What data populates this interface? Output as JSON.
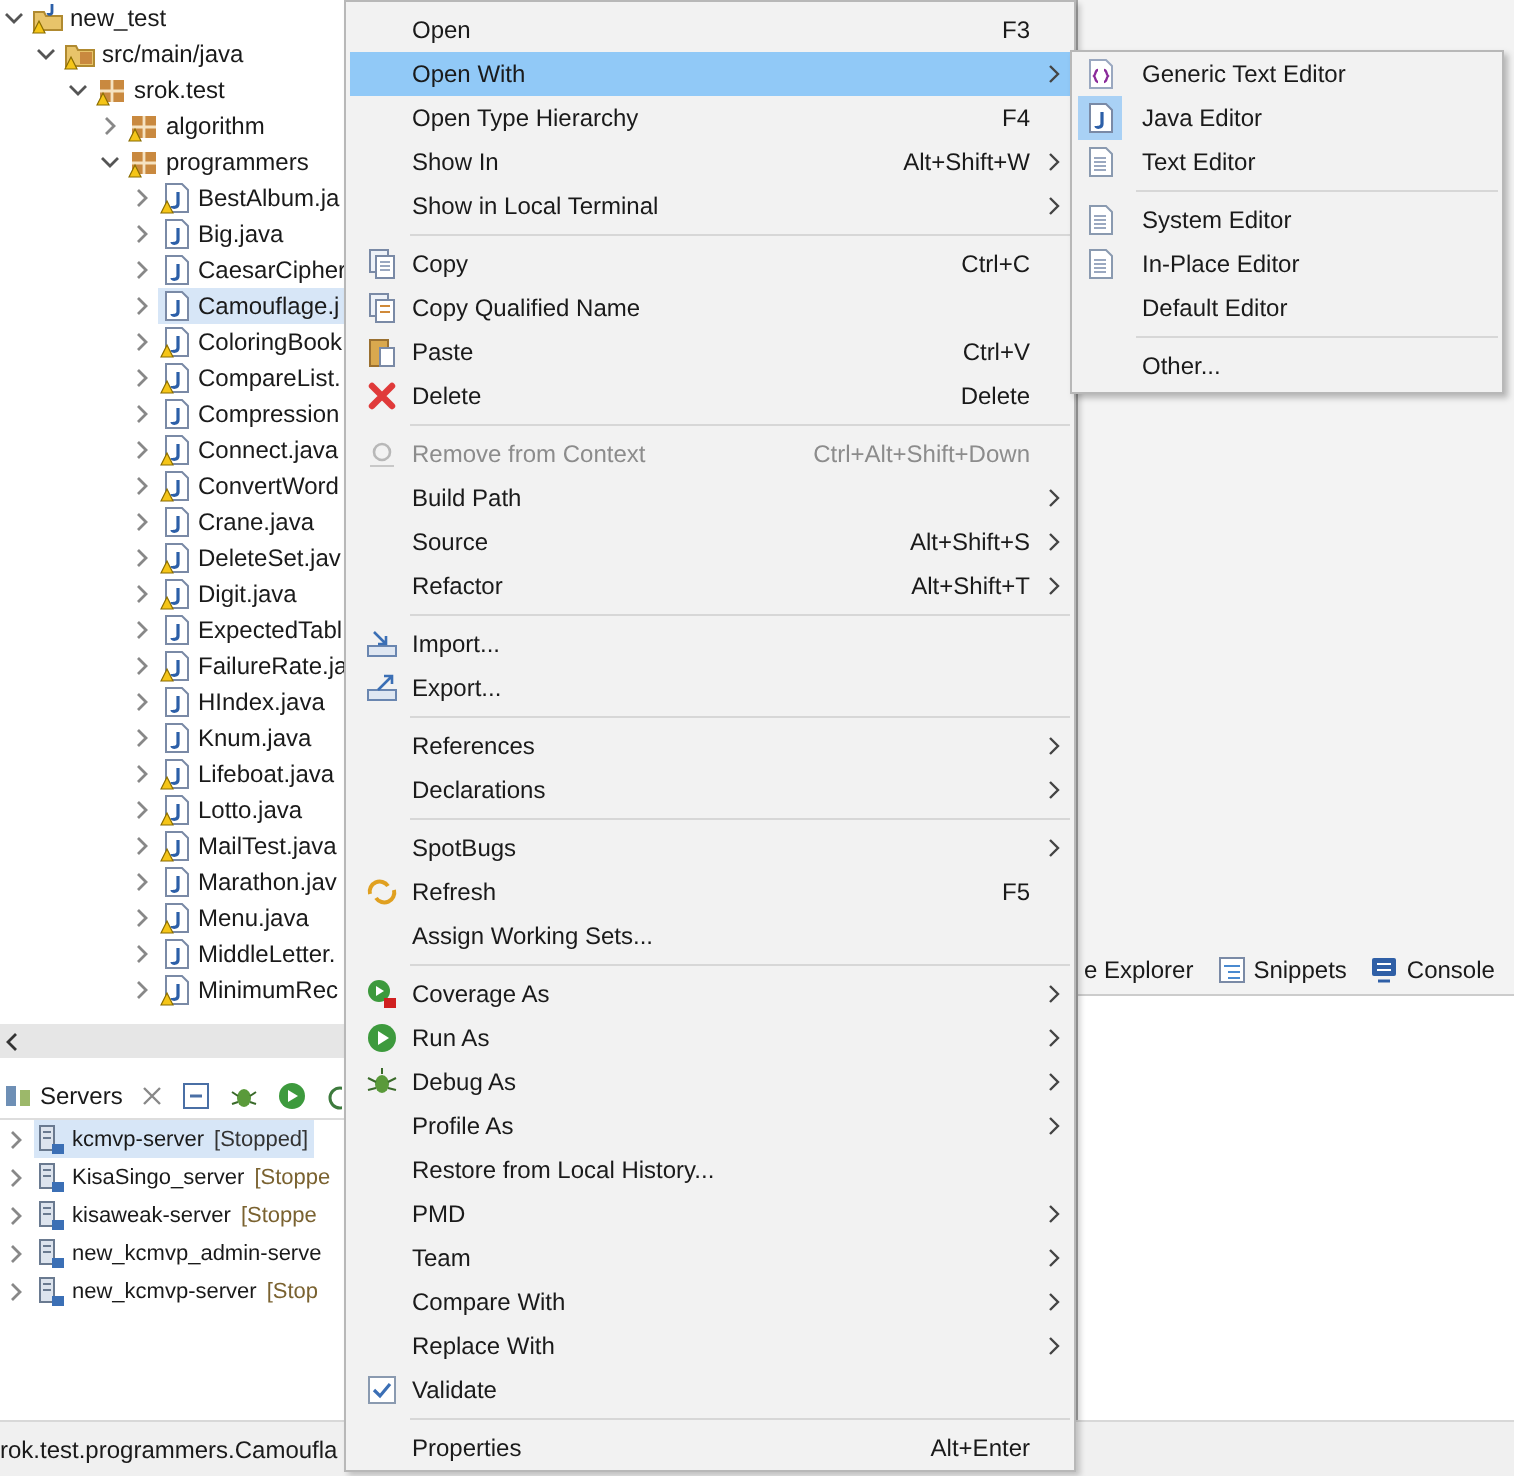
{
  "tree": [
    {
      "label": "new_test",
      "kind": "project",
      "expanded": true,
      "warning": true,
      "selected": false,
      "children": [
        {
          "label": "src/main/java",
          "kind": "source-folder",
          "expanded": true,
          "warning": true,
          "selected": false,
          "children": [
            {
              "label": "srok.test",
              "kind": "package",
              "expanded": true,
              "warning": true,
              "selected": false,
              "children": [
                {
                  "label": "algorithm",
                  "kind": "package",
                  "expanded": false,
                  "warning": true,
                  "selected": false
                },
                {
                  "label": "programmers",
                  "kind": "package",
                  "expanded": true,
                  "warning": true,
                  "selected": false,
                  "children": [
                    {
                      "label": "BestAlbum.ja",
                      "kind": "java-file",
                      "expanded": false,
                      "warning": true,
                      "selected": false
                    },
                    {
                      "label": "Big.java",
                      "kind": "java-file",
                      "expanded": false,
                      "warning": false,
                      "selected": false
                    },
                    {
                      "label": "CaesarCipher",
                      "kind": "java-file",
                      "expanded": false,
                      "warning": false,
                      "selected": false
                    },
                    {
                      "label": "Camouflage.j",
                      "kind": "java-file",
                      "expanded": false,
                      "warning": false,
                      "selected": true
                    },
                    {
                      "label": "ColoringBook",
                      "kind": "java-file",
                      "expanded": false,
                      "warning": true,
                      "selected": false
                    },
                    {
                      "label": "CompareList.",
                      "kind": "java-file",
                      "expanded": false,
                      "warning": true,
                      "selected": false
                    },
                    {
                      "label": "Compression",
                      "kind": "java-file",
                      "expanded": false,
                      "warning": false,
                      "selected": false
                    },
                    {
                      "label": "Connect.java",
                      "kind": "java-file",
                      "expanded": false,
                      "warning": true,
                      "selected": false
                    },
                    {
                      "label": "ConvertWord",
                      "kind": "java-file",
                      "expanded": false,
                      "warning": true,
                      "selected": false
                    },
                    {
                      "label": "Crane.java",
                      "kind": "java-file",
                      "expanded": false,
                      "warning": false,
                      "selected": false
                    },
                    {
                      "label": "DeleteSet.jav",
                      "kind": "java-file",
                      "expanded": false,
                      "warning": true,
                      "selected": false
                    },
                    {
                      "label": "Digit.java",
                      "kind": "java-file",
                      "expanded": false,
                      "warning": true,
                      "selected": false
                    },
                    {
                      "label": "ExpectedTabl",
                      "kind": "java-file",
                      "expanded": false,
                      "warning": false,
                      "selected": false
                    },
                    {
                      "label": "FailureRate.ja",
                      "kind": "java-file",
                      "expanded": false,
                      "warning": true,
                      "selected": false
                    },
                    {
                      "label": "HIndex.java",
                      "kind": "java-file",
                      "expanded": false,
                      "warning": false,
                      "selected": false
                    },
                    {
                      "label": "Knum.java",
                      "kind": "java-file",
                      "expanded": false,
                      "warning": false,
                      "selected": false
                    },
                    {
                      "label": "Lifeboat.java",
                      "kind": "java-file",
                      "expanded": false,
                      "warning": true,
                      "selected": false
                    },
                    {
                      "label": "Lotto.java",
                      "kind": "java-file",
                      "expanded": false,
                      "warning": true,
                      "selected": false
                    },
                    {
                      "label": "MailTest.java",
                      "kind": "java-file",
                      "expanded": false,
                      "warning": true,
                      "selected": false
                    },
                    {
                      "label": "Marathon.jav",
                      "kind": "java-file",
                      "expanded": false,
                      "warning": false,
                      "selected": false
                    },
                    {
                      "label": "Menu.java",
                      "kind": "java-file",
                      "expanded": false,
                      "warning": true,
                      "selected": false
                    },
                    {
                      "label": "MiddleLetter.",
                      "kind": "java-file",
                      "expanded": false,
                      "warning": false,
                      "selected": false
                    },
                    {
                      "label": "MinimumRec",
                      "kind": "java-file",
                      "expanded": false,
                      "warning": true,
                      "selected": false
                    }
                  ]
                }
              ]
            }
          ]
        }
      ]
    }
  ],
  "servers": {
    "title": "Servers",
    "rows": [
      {
        "name": "kcmvp-server",
        "status": "[Stopped]",
        "selected": true
      },
      {
        "name": "KisaSingo_server",
        "status": "[Stoppe",
        "selected": false
      },
      {
        "name": "kisaweak-server",
        "status": "[Stoppe",
        "selected": false
      },
      {
        "name": "new_kcmvp_admin-serve",
        "selected": false
      },
      {
        "name": "new_kcmvp-server",
        "status": "[Stop",
        "selected": false
      }
    ]
  },
  "bottom_tabs": [
    "e Explorer",
    "Snippets",
    "Console"
  ],
  "status_bar": "rok.test.programmers.Camoufla",
  "menu": {
    "sections": [
      [
        {
          "label": "Open",
          "shortcut": "F3",
          "submenu": false,
          "selected": false,
          "disabled": false
        },
        {
          "label": "Open With",
          "submenu": true,
          "selected": true,
          "disabled": false
        },
        {
          "label": "Open Type Hierarchy",
          "shortcut": "F4",
          "submenu": false,
          "selected": false,
          "disabled": false
        },
        {
          "label": "Show In",
          "shortcut": "Alt+Shift+W",
          "submenu": true,
          "selected": false,
          "disabled": false
        },
        {
          "label": "Show in Local Terminal",
          "submenu": true,
          "selected": false,
          "disabled": false
        }
      ],
      [
        {
          "label": "Copy",
          "shortcut": "Ctrl+C",
          "submenu": false,
          "selected": false,
          "disabled": false
        },
        {
          "label": "Copy Qualified Name",
          "submenu": false,
          "selected": false,
          "disabled": false
        },
        {
          "label": "Paste",
          "shortcut": "Ctrl+V",
          "submenu": false,
          "selected": false,
          "disabled": false
        },
        {
          "label": "Delete",
          "shortcut": "Delete",
          "submenu": false,
          "selected": false,
          "disabled": false
        }
      ],
      [
        {
          "label": "Remove from Context",
          "shortcut": "Ctrl+Alt+Shift+Down",
          "submenu": false,
          "selected": false,
          "disabled": true
        },
        {
          "label": "Build Path",
          "submenu": true,
          "selected": false,
          "disabled": false
        },
        {
          "label": "Source",
          "shortcut": "Alt+Shift+S",
          "submenu": true,
          "selected": false,
          "disabled": false
        },
        {
          "label": "Refactor",
          "shortcut": "Alt+Shift+T",
          "submenu": true,
          "selected": false,
          "disabled": false
        }
      ],
      [
        {
          "label": "Import...",
          "submenu": false,
          "selected": false,
          "disabled": false
        },
        {
          "label": "Export...",
          "submenu": false,
          "selected": false,
          "disabled": false
        }
      ],
      [
        {
          "label": "References",
          "submenu": true,
          "selected": false,
          "disabled": false
        },
        {
          "label": "Declarations",
          "submenu": true,
          "selected": false,
          "disabled": false
        }
      ],
      [
        {
          "label": "SpotBugs",
          "submenu": true,
          "selected": false,
          "disabled": false
        },
        {
          "label": "Refresh",
          "shortcut": "F5",
          "submenu": false,
          "selected": false,
          "disabled": false
        },
        {
          "label": "Assign Working Sets...",
          "submenu": false,
          "selected": false,
          "disabled": false
        }
      ],
      [
        {
          "label": "Coverage As",
          "submenu": true,
          "selected": false,
          "disabled": false
        },
        {
          "label": "Run As",
          "submenu": true,
          "selected": false,
          "disabled": false
        },
        {
          "label": "Debug As",
          "submenu": true,
          "selected": false,
          "disabled": false
        },
        {
          "label": "Profile As",
          "submenu": true,
          "selected": false,
          "disabled": false
        },
        {
          "label": "Restore from Local History...",
          "submenu": false,
          "selected": false,
          "disabled": false
        },
        {
          "label": "PMD",
          "submenu": true,
          "selected": false,
          "disabled": false
        },
        {
          "label": "Team",
          "submenu": true,
          "selected": false,
          "disabled": false
        },
        {
          "label": "Compare With",
          "submenu": true,
          "selected": false,
          "disabled": false
        },
        {
          "label": "Replace With",
          "submenu": true,
          "selected": false,
          "disabled": false
        },
        {
          "label": "Validate",
          "submenu": false,
          "selected": false,
          "disabled": false
        }
      ],
      [
        {
          "label": "Properties",
          "shortcut": "Alt+Enter",
          "submenu": false,
          "selected": false,
          "disabled": false
        }
      ]
    ]
  },
  "submenu": {
    "sections": [
      [
        {
          "label": "Generic Text Editor",
          "checked": false
        },
        {
          "label": "Java Editor",
          "checked": true
        },
        {
          "label": "Text Editor",
          "checked": false
        }
      ],
      [
        {
          "label": "System Editor",
          "checked": false
        },
        {
          "label": "In-Place Editor",
          "checked": false
        },
        {
          "label": "Default Editor",
          "checked": false
        }
      ],
      [
        {
          "label": "Other...",
          "checked": false
        }
      ]
    ]
  }
}
